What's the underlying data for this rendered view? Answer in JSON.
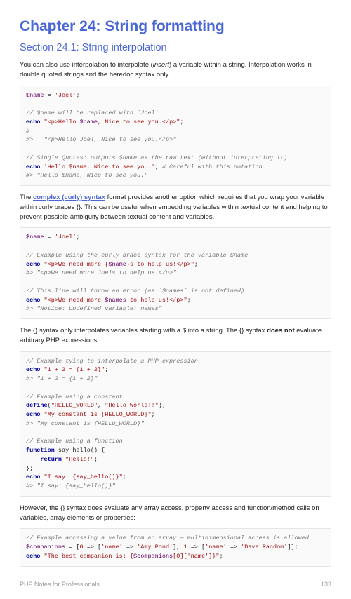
{
  "h1": "Chapter 24: String formatting",
  "h2": "Section 24.1: String interpolation",
  "p1a": "You can also use interpolation to interpolate (",
  "p1i": "insert",
  "p1b": ") a variable within a string. Interpolation works in double quoted strings and the heredoc syntax only.",
  "c1": "$name = 'Joel';\n\n// $name will be replaced with `Joel`\necho \"<p>Hello $name, Nice to see you.</p>\";\n#\n#>   \"<p>Hello Joel, Nice to see you.</p>\"\n\n// Single Quotes: outputs $name as the raw text (without interpreting it)\necho 'Hello $name, Nice to see you.'; # Careful with this notation\n#> \"Hello $name, Nice to see you.\"",
  "p2a": "The ",
  "p2link": "complex (curly) syntax",
  "p2b": " format provides another option which requires that you wrap your variable within curly braces {}. This can be useful when embedding variables within textual content and helping to prevent possible ambiguity between textual content and variables.",
  "c2": "$name = 'Joel';\n\n// Example using the curly brace syntax for the variable $name\necho \"<p>We need more {$name}s to help us!</p>\";\n#> \"<p>We need more Joels to help us!</p>\"\n\n// This line will throw an error (as `$names` is not defined)\necho \"<p>We need more $names to help us!</p>\";\n#> \"Notice: Undefined variable: names\"",
  "p3a": "The {} syntax only interpolates variables starting with a $ into a string. The {} syntax ",
  "p3b": "does not",
  "p3c": " evaluate arbitrary PHP expressions.",
  "c3": "// Example tying to interpolate a PHP expression\necho \"1 + 2 = {1 + 2}\";\n#> \"1 + 2 = {1 + 2}\"\n\n// Example using a constant\ndefine(\"HELLO_WORLD\", \"Hello World!!\");\necho \"My constant is {HELLO_WORLD}\";\n#> \"My constant is {HELLO_WORLD}\"\n\n// Example using a function\nfunction say_hello() {\n    return \"Hello!\";\n};\necho \"I say: {say_hello()}\";\n#> \"I say: {say_hello()}\"",
  "p4": "However, the {} syntax does evaluate any array access, property access and function/method calls on variables, array elements or properties:",
  "c4": "// Example accessing a value from an array — multidimensional access is allowed\n$companions = [0 => ['name' => 'Amy Pond'], 1 => ['name' => 'Dave Random']];\necho \"The best companion is: {$companions[0]['name']}\";",
  "footL": "PHP Notes for Professionals",
  "footR": "133"
}
